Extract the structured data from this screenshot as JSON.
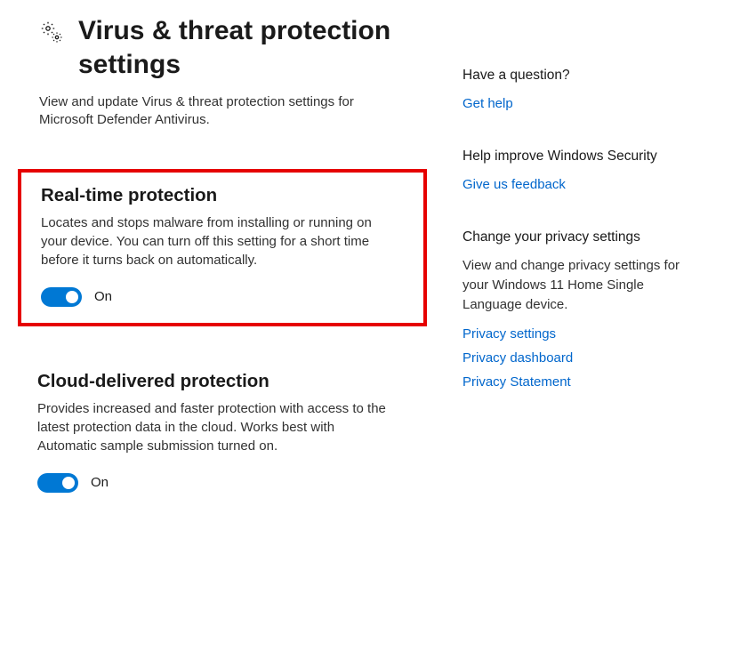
{
  "header": {
    "title": "Virus & threat protection settings",
    "description": "View and update Virus & threat protection settings for Microsoft Defender Antivirus."
  },
  "realtime": {
    "title": "Real-time protection",
    "description": "Locates and stops malware from installing or running on your device. You can turn off this setting for a short time before it turns back on automatically.",
    "state": "On"
  },
  "cloud": {
    "title": "Cloud-delivered protection",
    "description": "Provides increased and faster protection with access to the latest protection data in the cloud. Works best with Automatic sample submission turned on.",
    "state": "On"
  },
  "side": {
    "question": {
      "heading": "Have a question?",
      "link": "Get help"
    },
    "improve": {
      "heading": "Help improve Windows Security",
      "link": "Give us feedback"
    },
    "privacy": {
      "heading": "Change your privacy settings",
      "description": "View and change privacy settings for your Windows 11 Home Single Language device.",
      "links": {
        "settings": "Privacy settings",
        "dashboard": "Privacy dashboard",
        "statement": "Privacy Statement"
      }
    }
  }
}
